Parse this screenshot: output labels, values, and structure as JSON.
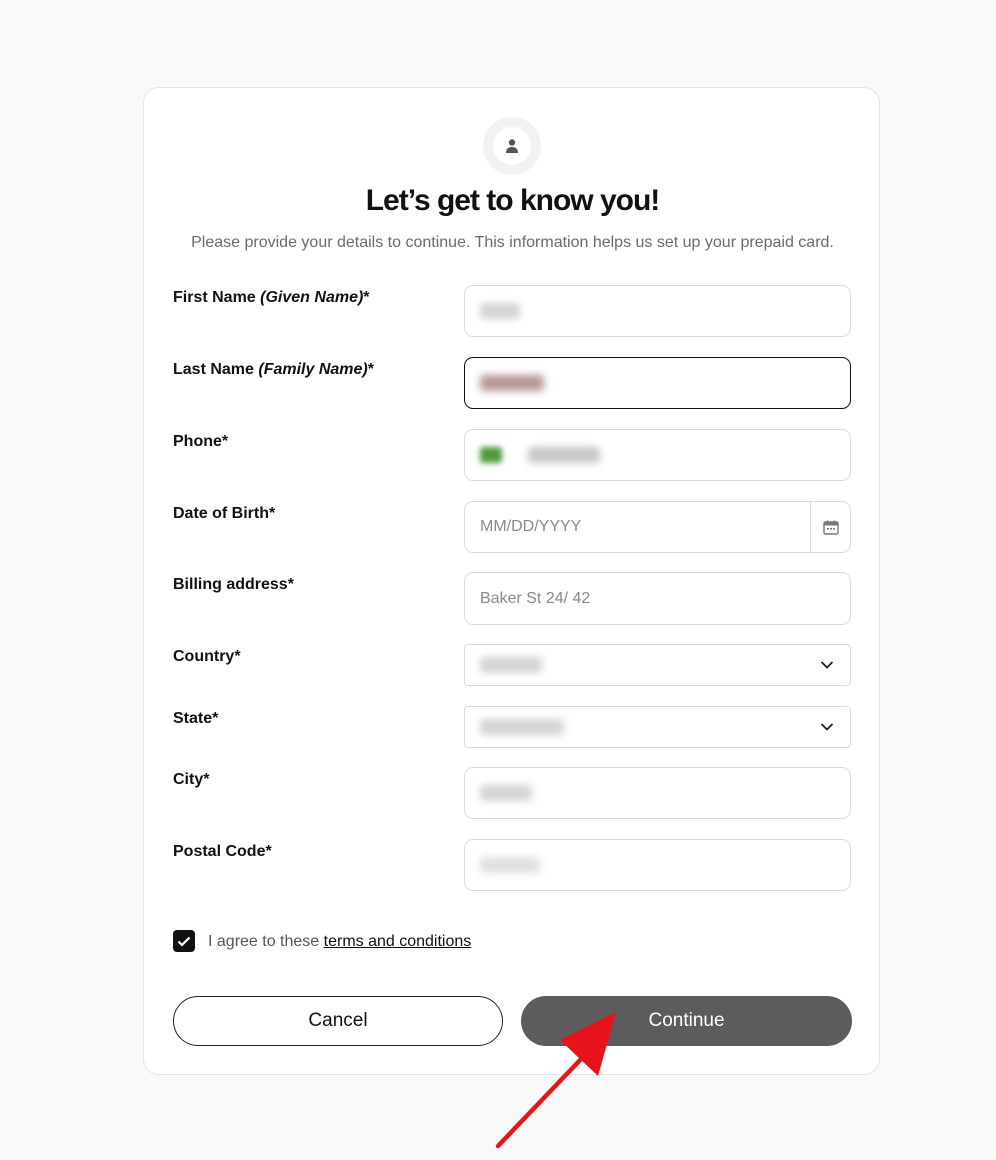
{
  "header": {
    "title": "Let’s get to know you!",
    "subtitle": "Please provide your details to continue. This information helps us set up your prepaid card."
  },
  "form": {
    "first_name": {
      "label": "First Name",
      "label_note": "(Given Name)",
      "required": "*"
    },
    "last_name": {
      "label": "Last Name",
      "label_note": "(Family Name)",
      "required": "*"
    },
    "phone": {
      "label": "Phone*"
    },
    "dob": {
      "label": "Date of Birth*",
      "placeholder": "MM/DD/YYYY"
    },
    "billing": {
      "label": "Billing address*",
      "placeholder": "Baker St 24/ 42"
    },
    "country": {
      "label": "Country*"
    },
    "state": {
      "label": "State*"
    },
    "city": {
      "label": "City*"
    },
    "postal": {
      "label": "Postal Code*"
    }
  },
  "agreement": {
    "prefix": "I agree to these",
    "link": "terms and conditions",
    "checked": true
  },
  "buttons": {
    "cancel": "Cancel",
    "continue": "Continue"
  },
  "annotation": {
    "color": "#e8141b"
  }
}
